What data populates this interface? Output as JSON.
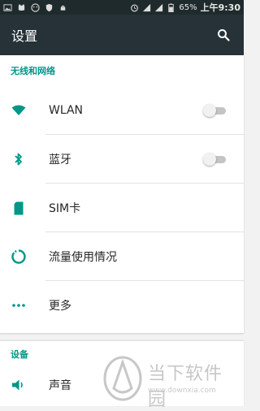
{
  "status_bar": {
    "battery": "65%",
    "time": "上午9:30"
  },
  "header": {
    "title": "设置"
  },
  "sections": [
    {
      "title": "无线和网络",
      "items": [
        {
          "label": "WLAN",
          "icon": "wifi-icon",
          "toggle": false
        },
        {
          "label": "蓝牙",
          "icon": "bluetooth-icon",
          "toggle": false
        },
        {
          "label": "SIM卡",
          "icon": "sim-card-icon"
        },
        {
          "label": "流量使用情况",
          "icon": "data-usage-icon"
        },
        {
          "label": "更多",
          "icon": "more-icon"
        }
      ]
    },
    {
      "title": "设备",
      "items": [
        {
          "label": "声音",
          "icon": "volume-icon"
        }
      ]
    }
  ],
  "watermark": {
    "brand": "当下软件园",
    "url": "www.downxia.com"
  },
  "colors": {
    "accent": "#009688",
    "app_bar": "#263238",
    "status_bar": "#1f2a2c"
  }
}
